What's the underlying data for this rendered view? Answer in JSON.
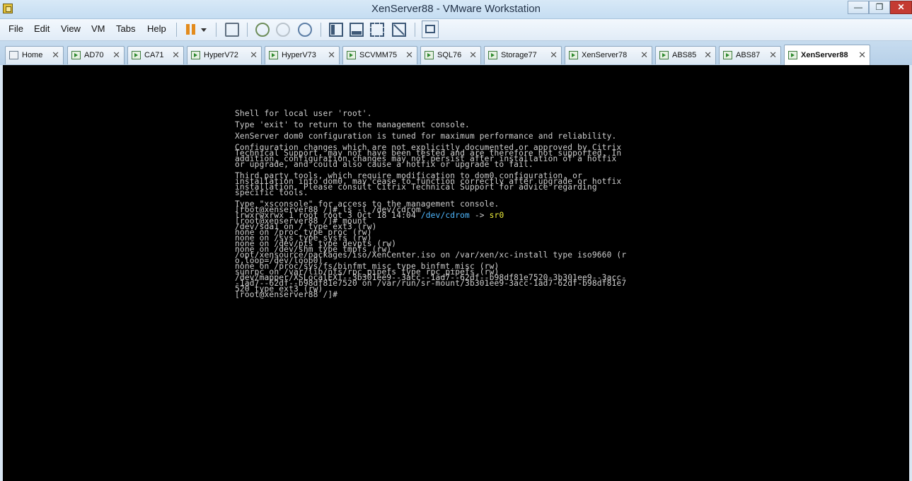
{
  "window": {
    "title": "XenServer88 - VMware Workstation",
    "minimize_glyph": "—",
    "maximize_glyph": "❐",
    "close_glyph": "✕"
  },
  "menu": {
    "items": [
      "File",
      "Edit",
      "View",
      "VM",
      "Tabs",
      "Help"
    ]
  },
  "toolbar": {
    "icons": [
      "pause-icon",
      "dropdown-icon",
      "network-icon",
      "snapshot-icon",
      "revert-snapshot-icon",
      "snapshot-manager-icon",
      "sidebar-icon",
      "bottom-bar-icon",
      "fullscreen-icon",
      "unity-icon",
      "console-view-icon"
    ]
  },
  "tabs": [
    {
      "label": "Home",
      "icon": "home-icon",
      "active": false
    },
    {
      "label": "AD70",
      "icon": "vm-icon",
      "active": false
    },
    {
      "label": "CA71",
      "icon": "vm-icon",
      "active": false
    },
    {
      "label": "HyperV72",
      "icon": "vm-icon",
      "active": false
    },
    {
      "label": "HyperV73",
      "icon": "vm-icon",
      "active": false
    },
    {
      "label": "SCVMM75",
      "icon": "vm-icon",
      "active": false
    },
    {
      "label": "SQL76",
      "icon": "vm-icon",
      "active": false
    },
    {
      "label": "Storage77",
      "icon": "vm-icon",
      "active": false
    },
    {
      "label": "XenServer78",
      "icon": "vm-icon",
      "active": false
    },
    {
      "label": "ABS85",
      "icon": "vm-icon",
      "active": false
    },
    {
      "label": "ABS87",
      "icon": "vm-icon",
      "active": false
    },
    {
      "label": "XenServer88",
      "icon": "vm-icon",
      "active": true
    }
  ],
  "tab_close_glyph": "✕",
  "terminal": {
    "lines": [
      "Shell for local user 'root'.",
      "",
      "Type 'exit' to return to the management console.",
      "",
      "XenServer dom0 configuration is tuned for maximum performance and reliability.",
      "",
      "Configuration changes which are not explicitly documented or approved by Citrix",
      "Technical Support, may not have been tested and are therefore not supported. In",
      "addition, configuration changes may not persist after installation of a hotfix",
      "or upgrade, and could also cause a hotfix or upgrade to fail.",
      "",
      "Third party tools, which require modification to dom0 configuration, or",
      "installation into dom0, may cease to function correctly after upgrade or hotfix",
      "installation. Please consult Citrix Technical Support for advice regarding",
      "specific tools.",
      "",
      "Type \"xsconsole\" for access to the management console.",
      "[root@xenserver88 /]# ls -l /dev/cdrom",
      "",
      "[root@xenserver88 /]# mount",
      "/dev/sda1 on / type ext3 (rw)",
      "none on /proc type proc (rw)",
      "none on /sys type sysfs (rw)",
      "none on /dev/pts type devpts (rw)",
      "none on /dev/shm type tmpfs (rw)",
      "/opt/xensource/packages/iso/XenCenter.iso on /var/xen/xc-install type iso9660 (r",
      "o,loop=/dev/loop0)",
      "none on /proc/sys/fs/binfmt_misc type binfmt_misc (rw)",
      "sunrpc on /var/lib/nfs/rpc_pipefs type rpc_pipefs (rw)",
      "/dev/mapper/XSLocalEXT--3b301ee9--3acc--1ad7--62df--b98df81e7520-3b301ee9--3acc-",
      "-1ad7--62df--b98df81e7520 on /var/run/sr-mount/3b301ee9-3acc-1ad7-62df-b98df81e7",
      "520 type ext3 (rw)",
      "[root@xenserver88 /]#"
    ],
    "cdrom_line": {
      "prefix": "lrwxrwxrwx 1 root root 3 Oct 18 14:04 ",
      "link": "/dev/cdrom",
      "arrow": " -> ",
      "target": "sr0",
      "link_color": "#4fb8ff",
      "target_color": "#f0f03c"
    },
    "text_color": "#cfcfcf",
    "background": "#000000"
  }
}
